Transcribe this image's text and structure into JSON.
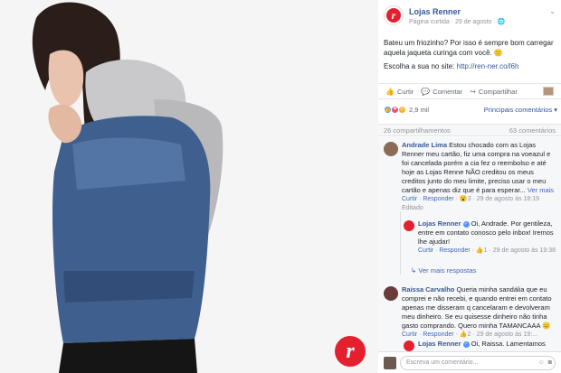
{
  "post": {
    "page_name": "Lojas Renner",
    "meta": "Página curtida · 29 de agosto · ",
    "globe": "🌐",
    "caption_line1": "Bateu um friozinho? Por isso é sempre bom carregar aquela jaqueta curinga com você. 🙂",
    "caption_line2_prefix": "Escolha a sua no site: ",
    "caption_link": "http://ren-ner.co/l6h",
    "logo_letter": "r"
  },
  "actions": {
    "like": "Curtir",
    "comment": "Comentar",
    "share": "Compartilhar"
  },
  "reactions": {
    "count": "2,9 mil",
    "sort": "Principais comentários ▾"
  },
  "stats": {
    "shares": "26 compartilhamentos",
    "comments": "63 comentários"
  },
  "comments": [
    {
      "name": "Andrade Lima",
      "text": " Estou chocado com as Lojas Renner meu cartão, fiz uma compra na voeazul e foi cancelada porém a cia fez o reembolso e até hoje as Lojas Renne NÃO creditou os meus creditos junto do meu limite, preciso usar o meu cartão e apenas diz que é para esperar...",
      "more": " Ver mais",
      "meta_like": "Curtir",
      "meta_reply": "Responder",
      "meta_reacts": "3",
      "meta_date": "29 de agosto às 18:19",
      "meta_edited": "Editado"
    },
    {
      "name": "Lojas Renner",
      "text": " Oi, Andrade. Por gentileza, entre em contato conosco pelo inbox! Iremos lhe ajudar!",
      "meta_like": "Curtir",
      "meta_reply": "Responder",
      "meta_reacts": "1",
      "meta_date": "29 de agosto às 19:38",
      "more_replies": "Ver mais respostas"
    },
    {
      "name": "Raissa Carvalho",
      "text": " Queria minha sandália que eu comprei e não recebi, e quando entrei em contato apenas me disseram q cancelaram e devolveram meu dinheiro. Se eu quisesse dinheiro não tinha gasto comprando. Quero minha TAMANCAAA 😑",
      "meta_like": "Curtir",
      "meta_reply": "Responder",
      "meta_reacts": "2",
      "meta_date": "29 de agosto às 19:..."
    },
    {
      "name": "Lojas Renner",
      "text": " Oi, Raissa. Lamentamos"
    }
  ],
  "write_placeholder": "Escreva um comentário...",
  "colors": {
    "brand_red": "#e4202e",
    "fb_link": "#365899",
    "like_blue": "#5890ff",
    "love_red": "#f25268",
    "haha_yellow": "#f7b125"
  }
}
